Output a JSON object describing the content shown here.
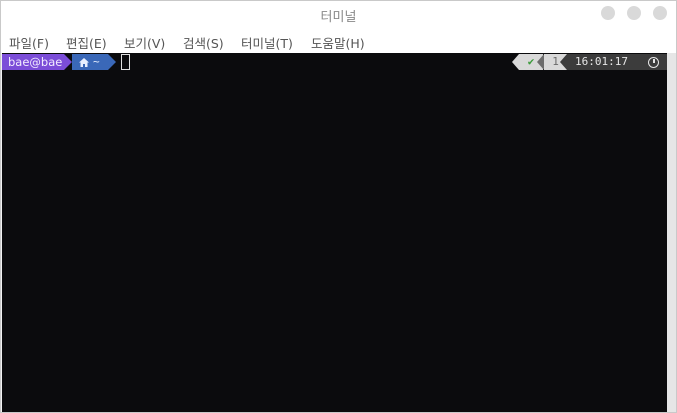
{
  "window": {
    "title": "터미널"
  },
  "menubar": {
    "items": [
      {
        "label": "파일(F)"
      },
      {
        "label": "편집(E)"
      },
      {
        "label": "보기(V)"
      },
      {
        "label": "검색(S)"
      },
      {
        "label": "터미널(T)"
      },
      {
        "label": "도움말(H)"
      }
    ]
  },
  "terminal": {
    "prompt": {
      "user_host": "bae@bae",
      "directory": "~",
      "directory_icon": "home-icon",
      "status_icon": "check-icon",
      "status_glyph": "✔",
      "job_count": "1",
      "time": "16:01:17",
      "time_icon": "clock-icon"
    }
  },
  "colors": {
    "terminal_bg": "#0b0b0d",
    "user_segment": "#7b4dd8",
    "dir_segment": "#3a68b8",
    "status_ok": "#3a9a3a",
    "time_segment": "#3c3c3c"
  }
}
